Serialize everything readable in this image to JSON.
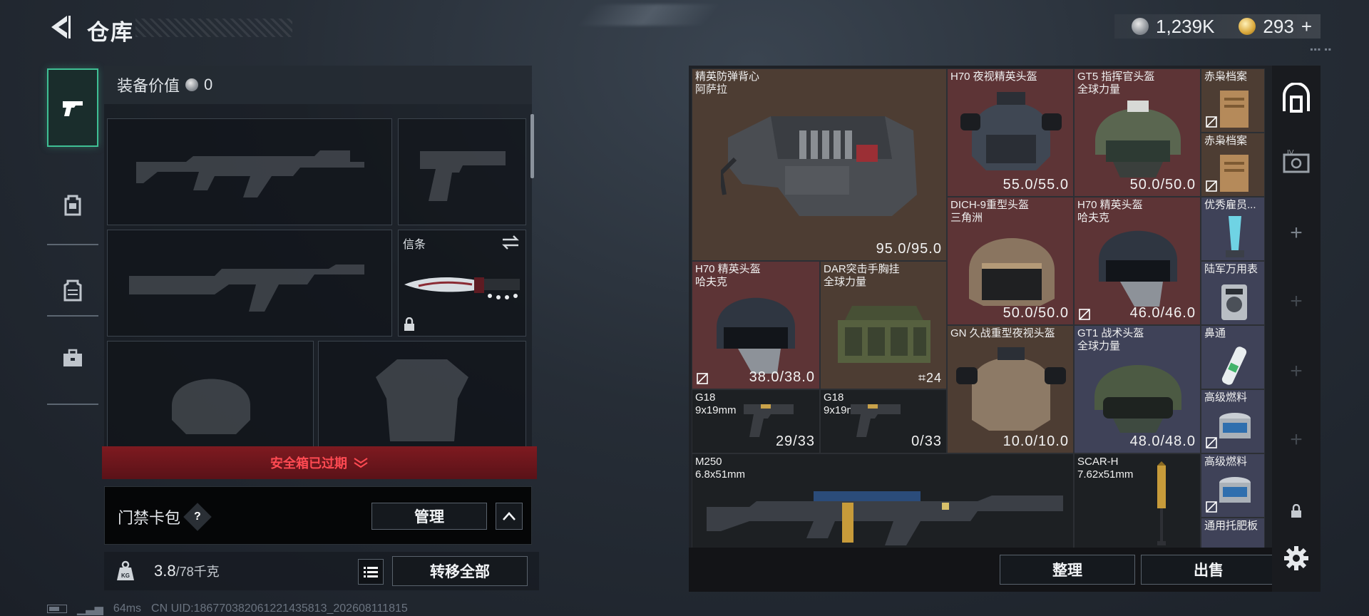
{
  "header": {
    "title": "仓库"
  },
  "currency": {
    "silver": "1,239K",
    "gold": "293",
    "gold_plus": "+"
  },
  "rail": {
    "tabs": [
      "weapon-tab",
      "backpack-tab",
      "armor-tab",
      "toolbox-tab"
    ]
  },
  "left_panel": {
    "equipment_value_label": "装备价值",
    "equipment_value": "0",
    "melee_slot_label": "信条",
    "safe_box_status": "安全箱已过期",
    "card_pack_label": "门禁卡包",
    "help_symbol": "?",
    "manage_label": "管理",
    "weight_current": "3.8",
    "weight_max": "/78千克",
    "transfer_all_label": "转移全部"
  },
  "status_bar": {
    "ping": "64ms",
    "uid": "CN UID:18677038206122143581​3_202608111815"
  },
  "stash": {
    "items": [
      {
        "id": "vest",
        "name": "精英防弹背心\n阿萨拉",
        "value": "95.0/95.0"
      },
      {
        "id": "h70-nv",
        "name": "H70 夜视精英头盔",
        "value": "55.0/55.0"
      },
      {
        "id": "gt5",
        "name": "GT5 指挥官头盔\n全球力量",
        "value": "50.0/50.0"
      },
      {
        "id": "file1",
        "name": "赤枭档案"
      },
      {
        "id": "file2",
        "name": "赤枭档案"
      },
      {
        "id": "dich9",
        "name": "DICH-9重型头盔\n三角洲",
        "value": "50.0/50.0"
      },
      {
        "id": "h70-b",
        "name": "H70 精英头盔\n哈夫克",
        "value": "46.0/46.0"
      },
      {
        "id": "award",
        "name": "优秀雇员..."
      },
      {
        "id": "watch",
        "name": "陆军万用表"
      },
      {
        "id": "h70-a",
        "name": "H70 精英头盔\n哈夫克",
        "value": "38.0/38.0"
      },
      {
        "id": "dar",
        "name": "DAR突击手胸挂\n全球力量",
        "value": "24"
      },
      {
        "id": "gn",
        "name": "GN 久战重型夜视头盔",
        "value": "10.0/10.0"
      },
      {
        "id": "gt1",
        "name": "GT1 战术头盔\n全球力量",
        "value": "48.0/48.0"
      },
      {
        "id": "nasal",
        "name": "鼻通"
      },
      {
        "id": "fuel1",
        "name": "高级燃料"
      },
      {
        "id": "g18a",
        "name": "G18\n9x19mm",
        "value": "29/33"
      },
      {
        "id": "g18b",
        "name": "G18\n9x19mm",
        "value": "0/33"
      },
      {
        "id": "m250",
        "name": "M250\n6.8x51mm"
      },
      {
        "id": "scar",
        "name": "SCAR-H\n7.62x51mm"
      },
      {
        "id": "fuel2",
        "name": "高级燃料"
      },
      {
        "id": "grease",
        "name": "通用托肥板"
      }
    ],
    "sort_label": "整理",
    "sell_label": "出售"
  },
  "colors": {
    "accent_green": "#3fbf94",
    "expired_red": "#ff4a52",
    "rarity_brown": "#4d3d33",
    "rarity_red": "#5d3436",
    "rarity_blue": "#3f4258"
  }
}
